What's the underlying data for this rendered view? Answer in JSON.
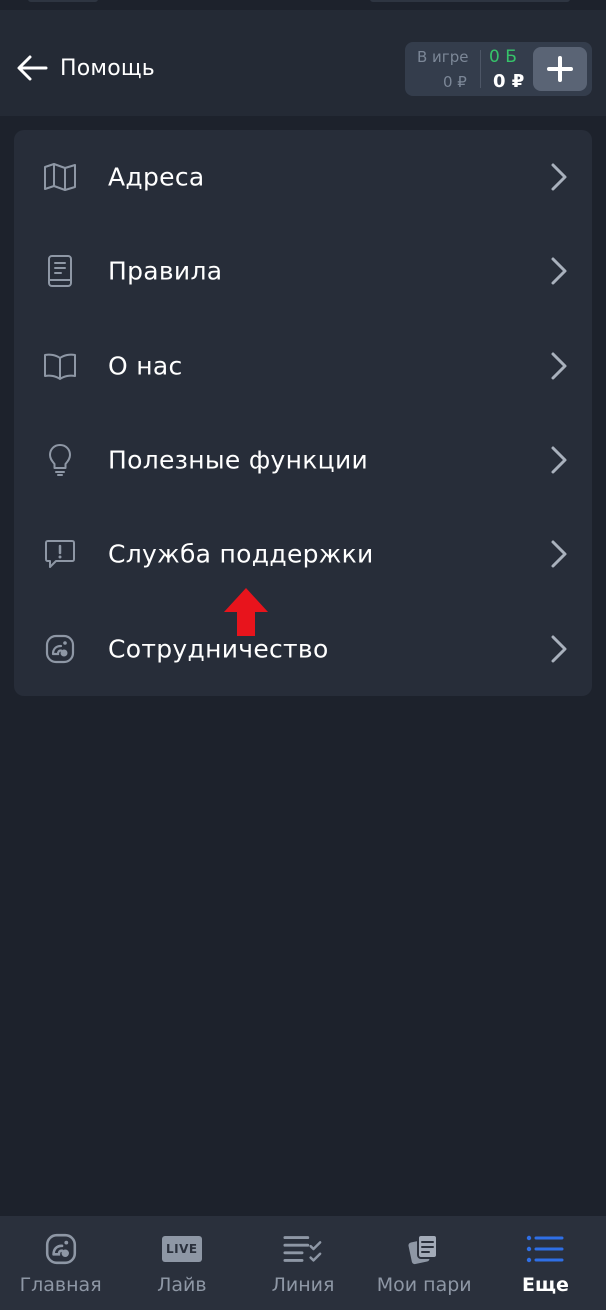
{
  "header": {
    "title": "Помощь",
    "balance": {
      "ingame_label": "В игре",
      "ingame_value": "0 ₽",
      "bonus_value": "0 Б",
      "money_value": "0 ₽"
    }
  },
  "menu": {
    "items": [
      {
        "label": "Адреса",
        "icon": "map-icon"
      },
      {
        "label": "Правила",
        "icon": "book-icon"
      },
      {
        "label": "О нас",
        "icon": "open-book-icon"
      },
      {
        "label": "Полезные функции",
        "icon": "lightbulb-icon"
      },
      {
        "label": "Служба поддержки",
        "icon": "chat-alert-icon"
      },
      {
        "label": "Сотрудничество",
        "icon": "partner-logo-icon"
      }
    ]
  },
  "bottom_nav": {
    "items": [
      {
        "label": "Главная",
        "icon": "home-logo-icon"
      },
      {
        "label": "Лайв",
        "icon": "live-icon",
        "badge": "LIVE"
      },
      {
        "label": "Линия",
        "icon": "list-check-icon"
      },
      {
        "label": "Мои пари",
        "icon": "tickets-icon"
      },
      {
        "label": "Еще",
        "icon": "menu-icon"
      }
    ],
    "active_index": 4
  },
  "colors": {
    "background": "#1d222c",
    "card": "#272d39",
    "bonus_green": "#36c36a",
    "active_blue": "#2f6fe6",
    "marker_red": "#e8141c"
  }
}
